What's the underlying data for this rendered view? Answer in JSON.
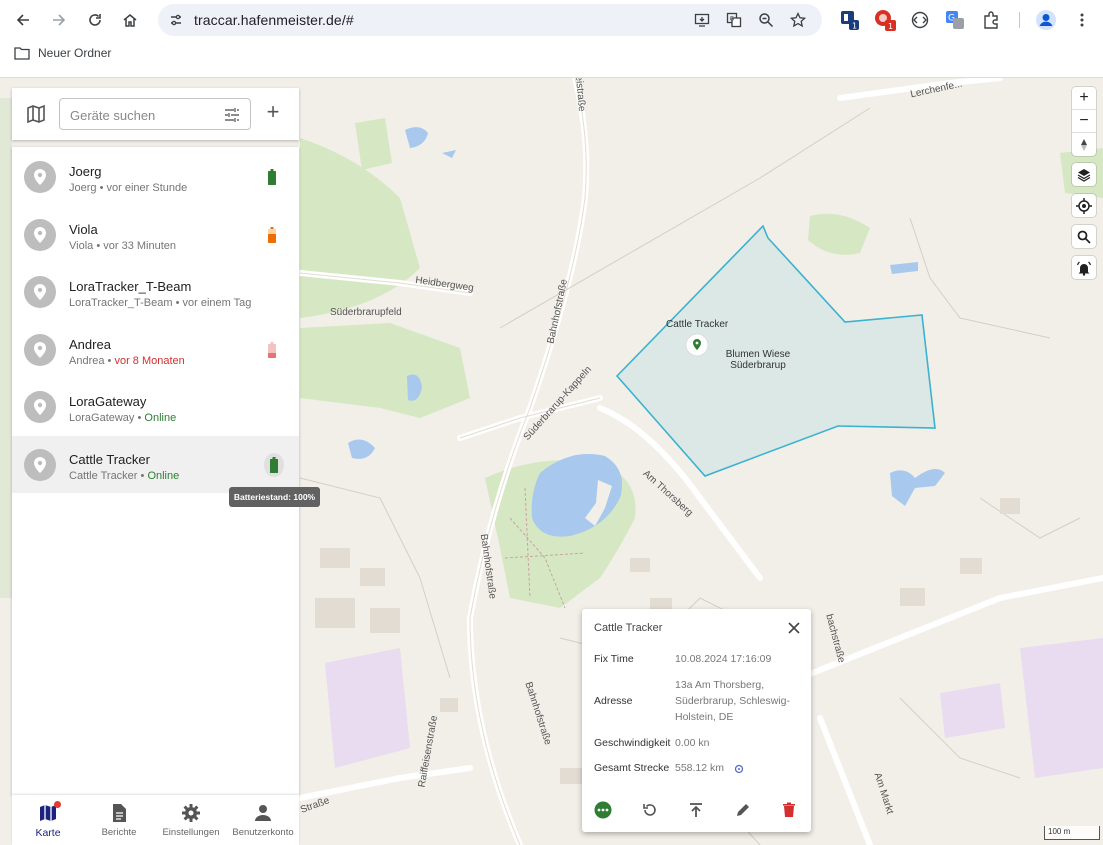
{
  "browser": {
    "url": "traccar.hafenmeister.de/#",
    "bookmark_label": "Neuer Ordner",
    "ext_badge_1": "1",
    "ext_badge_2": "1"
  },
  "search": {
    "placeholder": "Geräte suchen"
  },
  "devices": [
    {
      "name": "Joerg",
      "subtitle_name": "Joerg",
      "status": "vor einer Stunde",
      "status_color": "gray",
      "battery": "green"
    },
    {
      "name": "Viola",
      "subtitle_name": "Viola",
      "status": "vor 33 Minuten",
      "status_color": "gray",
      "battery": "orange"
    },
    {
      "name": "LoraTracker_T-Beam",
      "subtitle_name": "LoraTracker_T-Beam",
      "status": "vor einem Tag",
      "status_color": "gray",
      "battery": "none"
    },
    {
      "name": "Andrea",
      "subtitle_name": "Andrea",
      "status": "vor 8 Monaten",
      "status_color": "red",
      "battery": "red"
    },
    {
      "name": "LoraGateway",
      "subtitle_name": "LoraGateway",
      "status": "Online",
      "status_color": "green",
      "battery": "none"
    },
    {
      "name": "Cattle Tracker",
      "subtitle_name": "Cattle Tracker",
      "status": "Online",
      "status_color": "green",
      "battery": "green"
    }
  ],
  "separator": " • ",
  "tooltip": "Batteriestand: 100%",
  "bottom_nav": [
    {
      "label": "Karte",
      "active": true
    },
    {
      "label": "Berichte",
      "active": false
    },
    {
      "label": "Einstellungen",
      "active": false
    },
    {
      "label": "Benutzerkonto",
      "active": false
    }
  ],
  "map": {
    "labels": {
      "heidbergweg": "Heidbergweg",
      "suederbrarupfeld": "Süderbrarupfeld",
      "bahnhofstrasse": "Bahnhofstraße",
      "suederbrarup_kappeln": "Süderbrarup-Kappeln",
      "am_thorsberg": "Am Thorsberg",
      "raiffeisenstrasse": "Raiffeisenstraße",
      "am_markt": "Am Markt",
      "lerchenfeld": "Lerchenfe...",
      "str": "Straße",
      "bachstrasse": "bachstraße",
      "partial": "eistraße"
    },
    "marker_label": "Cattle Tracker",
    "geofence_line1": "Blumen Wiese",
    "geofence_line2": "Süderbrarup",
    "scale": "100 m",
    "colors": {
      "geofence": "#3bb2d0",
      "marker": "#2e7d32"
    }
  },
  "popup": {
    "title": "Cattle Tracker",
    "rows": [
      {
        "key": "Fix Time",
        "value": "10.08.2024 17:16:09"
      },
      {
        "key": "Adresse",
        "value_lines": [
          "13a Am Thorsberg,",
          "Süderbrarup, Schleswig-",
          "Holstein, DE"
        ]
      },
      {
        "key": "Geschwindigkeit",
        "value": "0.00 kn"
      },
      {
        "key": "Gesamt Strecke",
        "value": "558.12 km"
      }
    ]
  }
}
